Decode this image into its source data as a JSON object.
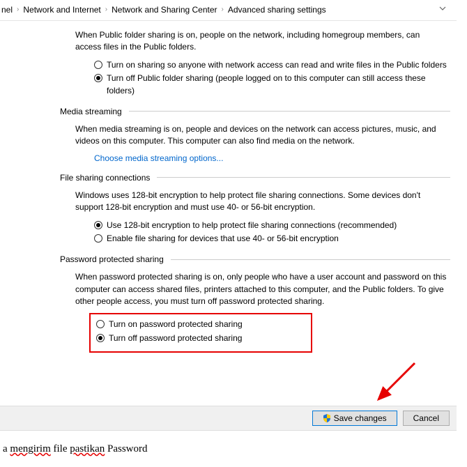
{
  "breadcrumb": {
    "items": [
      "nel",
      "Network and Internet",
      "Network and Sharing Center",
      "Advanced sharing settings"
    ]
  },
  "publicFolder": {
    "desc": "When Public folder sharing is on, people on the network, including homegroup members, can access files in the Public folders.",
    "opt1": "Turn on sharing so anyone with network access can read and write files in the Public folders",
    "opt2": "Turn off Public folder sharing (people logged on to this computer can still access these folders)"
  },
  "media": {
    "title": "Media streaming",
    "desc": "When media streaming is on, people and devices on the network can access pictures, music, and videos on this computer. This computer can also find media on the network.",
    "link": "Choose media streaming options..."
  },
  "fileConn": {
    "title": "File sharing connections",
    "desc": "Windows uses 128-bit encryption to help protect file sharing connections. Some devices don't support 128-bit encryption and must use 40- or 56-bit encryption.",
    "opt1": "Use 128-bit encryption to help protect file sharing connections (recommended)",
    "opt2": "Enable file sharing for devices that use 40- or 56-bit encryption"
  },
  "password": {
    "title": "Password protected sharing",
    "desc": "When password protected sharing is on, only people who have a user account and password on this computer can access shared files, printers attached to this computer, and the Public folders. To give other people access, you must turn off password protected sharing.",
    "opt1": "Turn on password protected sharing",
    "opt2": "Turn off password protected sharing"
  },
  "buttons": {
    "save": "Save changes",
    "cancel": "Cancel"
  },
  "belowText": {
    "w1": "a",
    "w2": "mengirim",
    "w3": "file",
    "w4": "pastikan",
    "w5": "Password"
  }
}
